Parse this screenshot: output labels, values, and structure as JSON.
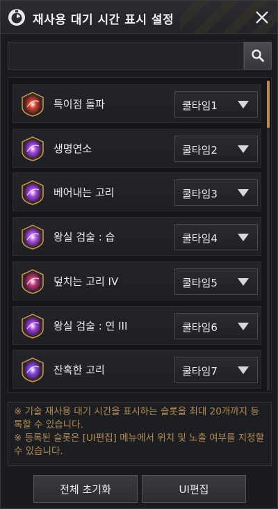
{
  "window": {
    "title": "재사용 대기 시간 표시 설정",
    "close_icon": "close-icon",
    "title_icon": "timer-icon"
  },
  "search": {
    "value": "",
    "placeholder": "",
    "button_icon": "search-icon"
  },
  "skills": [
    {
      "name": "특이점 돌파",
      "dropdown": "쿨타임1",
      "icon": "flame-figure-icon",
      "color": "#d2452a"
    },
    {
      "name": "생명연소",
      "dropdown": "쿨타임2",
      "icon": "purple-burst-icon",
      "color": "#a64ae0"
    },
    {
      "name": "베어내는 고리",
      "dropdown": "쿨타임3",
      "icon": "purple-slash-icon",
      "color": "#a64ae0"
    },
    {
      "name": "왕실 검술 : 습",
      "dropdown": "쿨타임4",
      "icon": "purple-blade-icon",
      "color": "#b25ae8"
    },
    {
      "name": "덮치는 고리 IV",
      "dropdown": "쿨타임5",
      "icon": "magenta-hook-icon",
      "color": "#c23a7a"
    },
    {
      "name": "왕실 검술 : 연 III",
      "dropdown": "쿨타임6",
      "icon": "purple-orb-icon",
      "color": "#a040d8"
    },
    {
      "name": "잔혹한 고리",
      "dropdown": "쿨타임7",
      "icon": "purple-swirl-icon",
      "color": "#8a4ae0"
    }
  ],
  "notice": {
    "line1": "※ 기술 재사용 대기 시간을 표시하는 슬롯을 최대 20개까지 등록할 수 있습니다.",
    "line2": "※ 등록된 슬롯은 [UI편집] 메뉴에서 위치 및 노출 여부를 지정할 수 있습니다."
  },
  "buttons": {
    "reset": "전체 초기화",
    "ui_edit": "UI편집"
  },
  "colors": {
    "notice_text": "#b38a56",
    "scroll_thumb": "#c08a52",
    "background": "#1a1b1f"
  }
}
